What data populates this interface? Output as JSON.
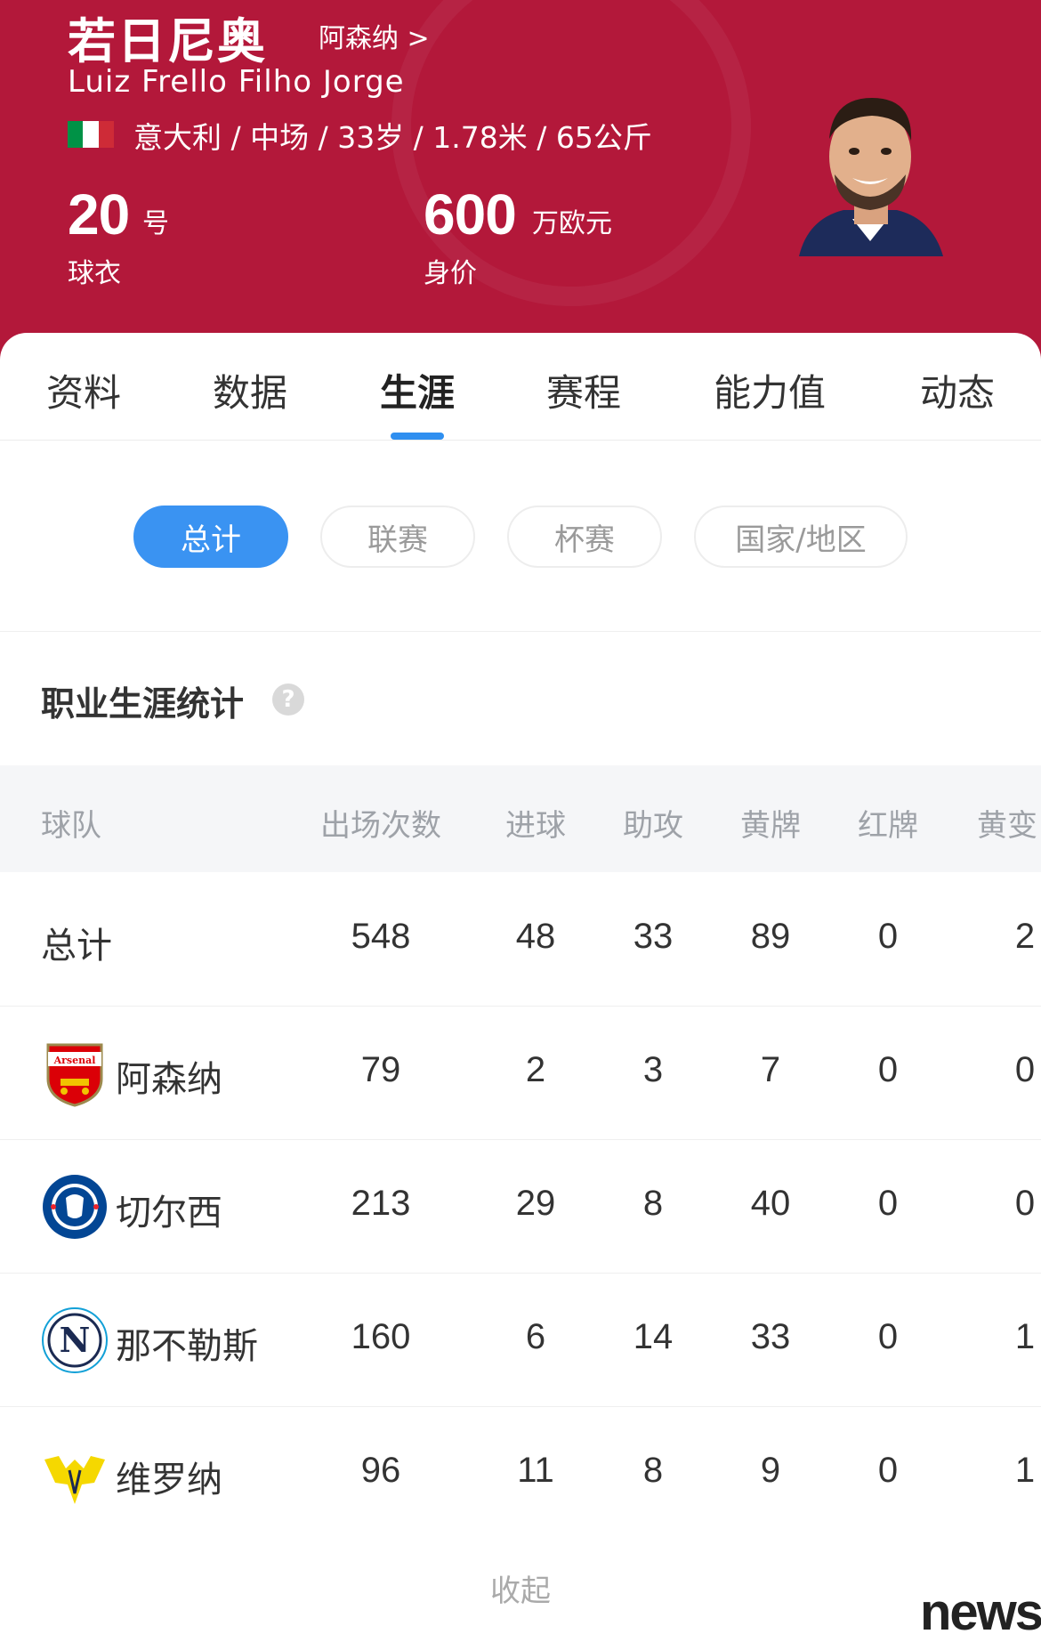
{
  "player": {
    "name_cn": "若日尼奥",
    "team_link": "阿森纳 >",
    "name_en": "Luiz Frello Filho Jorge",
    "info": "意大利 / 中场 / 33岁 / 1.78米 / 65公斤",
    "flag_colors": [
      "#009246",
      "#ffffff",
      "#ce2b37"
    ],
    "jersey_number": "20",
    "jersey_unit": "号",
    "jersey_label": "球衣",
    "value": "600",
    "value_unit": "万欧元",
    "value_label": "身价"
  },
  "tabs": [
    {
      "label": "资料"
    },
    {
      "label": "数据"
    },
    {
      "label": "生涯",
      "active": true
    },
    {
      "label": "赛程"
    },
    {
      "label": "能力值"
    },
    {
      "label": "动态"
    }
  ],
  "filters": [
    {
      "label": "总计",
      "active": true
    },
    {
      "label": "联赛"
    },
    {
      "label": "杯赛"
    },
    {
      "label": "国家/地区"
    }
  ],
  "section_title": "职业生涯统计",
  "table": {
    "headers": [
      "球队",
      "出场次数",
      "进球",
      "助攻",
      "黄牌",
      "红牌",
      "黄变"
    ],
    "rows": [
      {
        "team": "总计",
        "values": [
          "548",
          "48",
          "33",
          "89",
          "0",
          "2"
        ]
      },
      {
        "team": "阿森纳",
        "logo": "arsenal-logo",
        "values": [
          "79",
          "2",
          "3",
          "7",
          "0",
          "0"
        ]
      },
      {
        "team": "切尔西",
        "logo": "chelsea-logo",
        "values": [
          "213",
          "29",
          "8",
          "40",
          "0",
          "0"
        ]
      },
      {
        "team": "那不勒斯",
        "logo": "napoli-logo",
        "values": [
          "160",
          "6",
          "14",
          "33",
          "0",
          "1"
        ]
      },
      {
        "team": "维罗纳",
        "logo": "verona-logo",
        "values": [
          "96",
          "11",
          "8",
          "9",
          "0",
          "1"
        ]
      }
    ]
  },
  "collapse_label": "收起",
  "watermark_label": "news",
  "colors": {
    "header_bg": "#b3183a",
    "accent": "#3a93f2"
  }
}
